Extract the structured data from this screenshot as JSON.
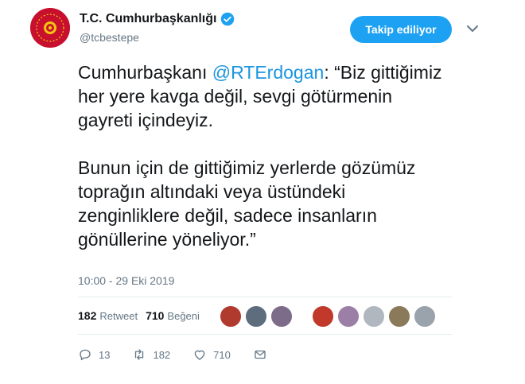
{
  "account": {
    "name": "T.C. Cumhurbaşkanlığı",
    "handle": "@tcbestepe",
    "follow_label": "Takip ediliyor"
  },
  "tweet": {
    "p1_prefix": "Cumhurbaşkanı ",
    "mention": "@RTErdogan",
    "p1_suffix": ": “Biz gittiğimiz her yere kavga değil, sevgi götürmenin gayreti içindeyiz.",
    "p2": "Bunun için de gittiğimiz yerlerde gözümüz toprağın altındaki veya üstündeki zenginliklere değil, sadece insanların gönüllerine yöneliyor.”",
    "timestamp": "10:00 - 29 Eki 2019"
  },
  "stats": {
    "retweet_count": "182",
    "retweet_label": "Retweet",
    "like_count": "710",
    "like_label": "Beğeni"
  },
  "liker_avatar_colors": [
    "#b03a2e",
    "#5d6d7e",
    "#7d6b8a",
    "#c0392b",
    "#9b7fa6",
    "#b0b7bf",
    "#8a7a5a",
    "#9aa3ab"
  ],
  "actions": {
    "reply_count": "13",
    "retweet_count": "182",
    "like_count": "710"
  },
  "colors": {
    "accent": "#1da1f2",
    "mention": "#1b95e0",
    "muted": "#657786",
    "avatar_bg": "#c8102e"
  }
}
